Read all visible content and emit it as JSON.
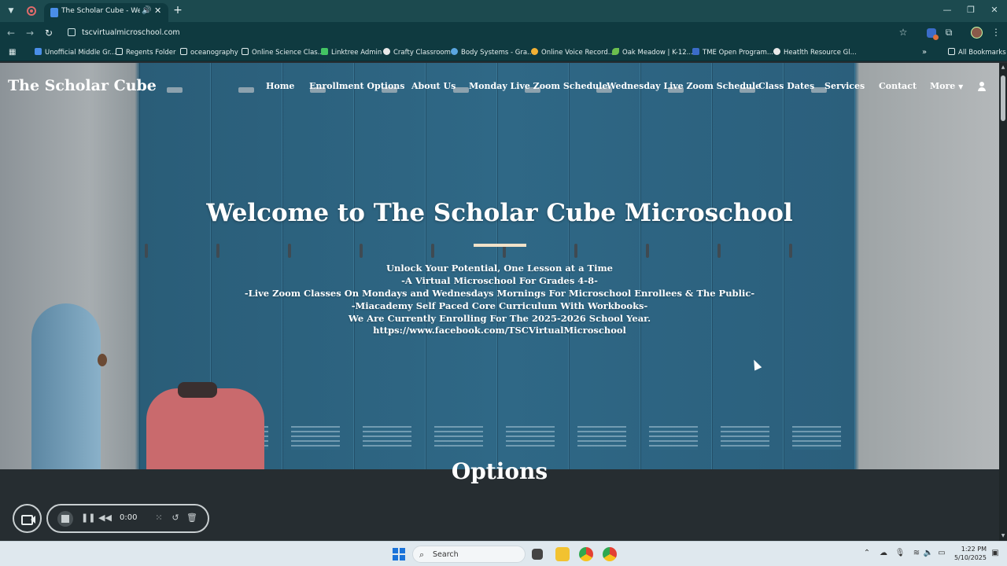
{
  "browser": {
    "tab_title": "The Scholar Cube - Welcom",
    "url": "tscvirtualmicroschool.com",
    "bookmarks": [
      {
        "label": "Unofficial Middle Gr...",
        "color": "#4a8ee8"
      },
      {
        "label": "Regents Folder",
        "color": "folder"
      },
      {
        "label": "oceanography",
        "color": "folder"
      },
      {
        "label": "Online Science Clas...",
        "color": "folder"
      },
      {
        "label": "Linktree Admin",
        "color": "#43c463"
      },
      {
        "label": "Crafty Classroom",
        "color": "#e9e9e9"
      },
      {
        "label": "Body Systems - Gra...",
        "color": "#5aa6e0"
      },
      {
        "label": "Online Voice Record...",
        "color": "#f2b134"
      },
      {
        "label": "Oak Meadow | K-12...",
        "color": "#6cbf4e"
      },
      {
        "label": "TME Open Program...",
        "color": "#3b6cc9"
      },
      {
        "label": "Heatlth Resource Gl...",
        "color": "#e9e9e9"
      }
    ],
    "all_bookmarks": "All Bookmarks",
    "accent_color": "#0f3a40"
  },
  "site": {
    "title": "The Scholar Cube",
    "nav": [
      "Home",
      "Enrollment Options",
      "About Us",
      "Monday Live Zoom Schedule",
      "Wednesday Live Zoom Schedule",
      "Class Dates",
      "Services",
      "Contact",
      "More"
    ]
  },
  "hero": {
    "title": "Welcome to The Scholar Cube Microschool",
    "lines": [
      "Unlock Your Potential, One Lesson at a Time",
      "-A Virtual Microschool For Grades 4-8-",
      "-Live Zoom Classes On Mondays and Wednesdays Mornings For Microschool Enrollees & The Public-",
      "-Miacademy Self Paced Core Curriculum With Workbooks-",
      "We Are Currently Enrolling For The 2025-2026 School Year.",
      "https://www.facebook.com/TSCVirtualMicroschool"
    ]
  },
  "section": {
    "options_title": "Options"
  },
  "recorder": {
    "time": "0:00"
  },
  "taskbar": {
    "search_label": "Search",
    "time": "1:22 PM",
    "date": "5/10/2025"
  }
}
